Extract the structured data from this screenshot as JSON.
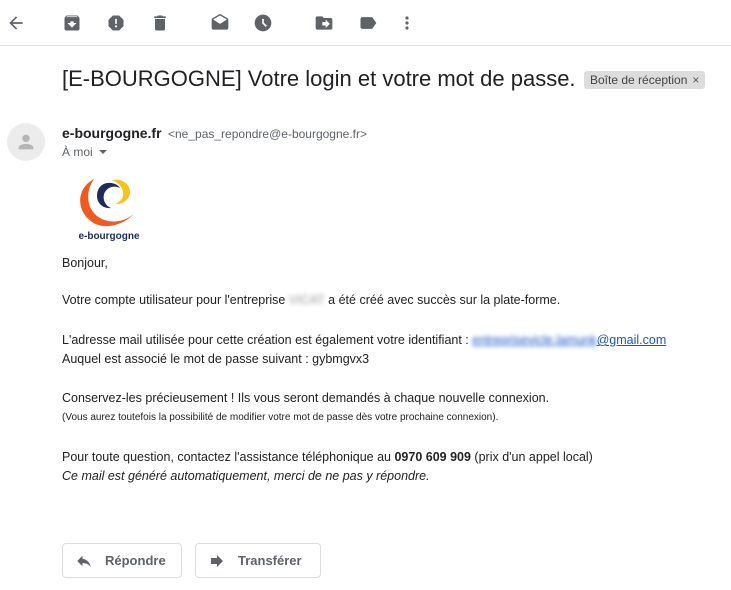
{
  "toolbar": {
    "icons": [
      "back-arrow-icon",
      "archive-icon",
      "report-spam-icon",
      "delete-icon",
      "mark-unread-icon",
      "snooze-icon",
      "move-to-icon",
      "label-icon",
      "more-icon"
    ]
  },
  "email": {
    "subject": "[E-BOURGOGNE] Votre login et votre mot de passe.",
    "label": "Boîte de réception",
    "label_close": "×",
    "sender_name": "e-bourgogne.fr",
    "sender_email": "<ne_pas_repondre@e-bourgogne.fr>",
    "recipient": "À moi",
    "logo_text": "e-bourgogne",
    "greeting": "Bonjour,",
    "line1_pre": "Votre compte utilisateur pour l'entreprise ",
    "line1_redacted": "VICAT",
    "line1_post": " a été créé avec succès sur la plate-forme.",
    "line2_pre": "L'adresse mail utilisée pour cette création est également votre identifiant : ",
    "line2_redacted": "entreprisevicle.lamunk",
    "line2_domain": "@gmail.com",
    "line3": "Auquel est associé le mot de passe suivant : gybmgvx3",
    "line4": "Conservez-les précieusement ! Ils vous seront demandés à chaque nouvelle connexion.",
    "line5": "(Vous aurez toutefois la possibilité de modifier votre mot de passe dès votre prochaine connexion).",
    "line6_pre": "Pour toute question, contactez l'assistance téléphonique au ",
    "line6_phone": "0970 609 909",
    "line6_post": " (prix d'un appel local)",
    "line7": "Ce mail est généré automatiquement, merci de ne pas y répondre."
  },
  "actions": {
    "reply": "Répondre",
    "forward": "Transférer"
  },
  "colors": {
    "link": "#1a56c9",
    "logo_orange": "#f05a1e",
    "logo_yellow": "#f7c41e",
    "logo_navy": "#1e2b5c"
  }
}
